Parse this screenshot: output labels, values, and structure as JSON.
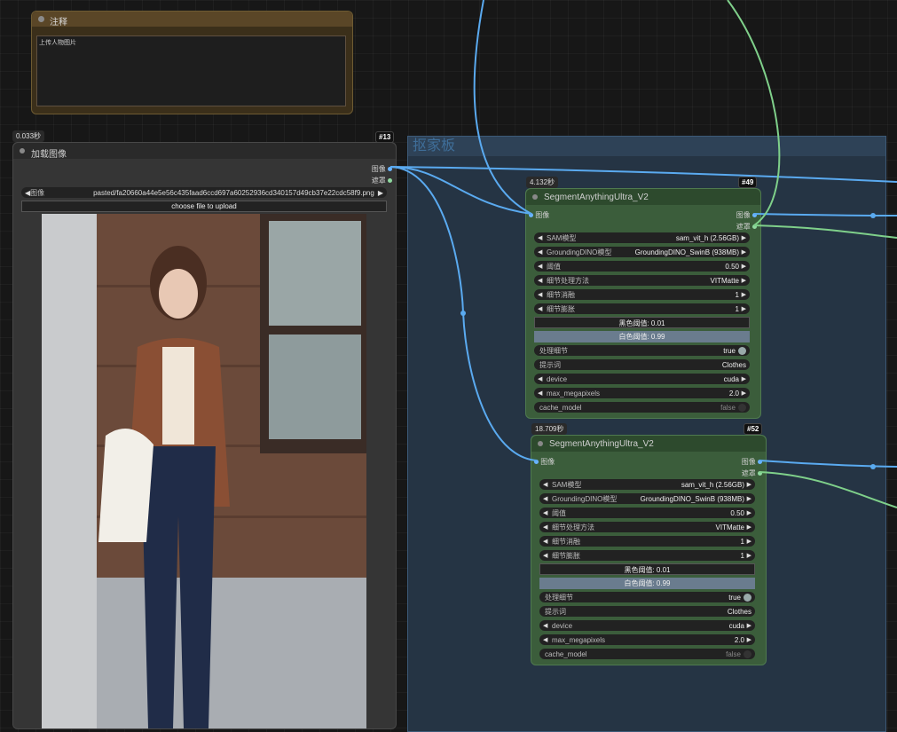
{
  "note": {
    "title": "注释",
    "text": "上传人物图片"
  },
  "group": {
    "title": "抠家板"
  },
  "load_node": {
    "time": "0.033秒",
    "id": "#13",
    "title": "加载图像",
    "outputs": [
      "图像",
      "遮罩"
    ],
    "image_widget_label": "图像",
    "image_filename": "pasted/fa20660a44e5e56c435faad6ccd697a60252936cd340157d49cb37e22cdc58f9.png",
    "upload_button": "choose file to upload"
  },
  "seg_nodes": [
    {
      "time": "4.132秒",
      "id": "#49",
      "title": "SegmentAnythingUltra_V2",
      "input": "图像",
      "outputs": [
        "图像",
        "遮罩"
      ],
      "widgets": [
        {
          "label": "SAM模型",
          "value": "sam_vit_h (2.56GB)"
        },
        {
          "label": "GroundingDINO模型",
          "value": "GroundingDINO_SwinB (938MB)"
        },
        {
          "label": "阈值",
          "value": "0.50"
        },
        {
          "label": "细节处理方法",
          "value": "VITMatte"
        },
        {
          "label": "细节消融",
          "value": "1"
        },
        {
          "label": "细节膨胀",
          "value": "1"
        }
      ],
      "black_point": "黑色阈值: 0.01",
      "white_point": "白色阈值: 0.99",
      "process_detail": {
        "label": "处理细节",
        "value": "true"
      },
      "prompt": {
        "label": "提示词",
        "value": "Clothes"
      },
      "device": {
        "label": "device",
        "value": "cuda"
      },
      "max_megapixels": {
        "label": "max_megapixels",
        "value": "2.0"
      },
      "cache_model": {
        "label": "cache_model",
        "value": "false"
      }
    },
    {
      "time": "18.709秒",
      "id": "#52",
      "title": "SegmentAnythingUltra_V2",
      "input": "图像",
      "outputs": [
        "图像",
        "遮罩"
      ],
      "widgets": [
        {
          "label": "SAM模型",
          "value": "sam_vit_h (2.56GB)"
        },
        {
          "label": "GroundingDINO模型",
          "value": "GroundingDINO_SwinB (938MB)"
        },
        {
          "label": "阈值",
          "value": "0.50"
        },
        {
          "label": "细节处理方法",
          "value": "VITMatte"
        },
        {
          "label": "细节消融",
          "value": "1"
        },
        {
          "label": "细节膨胀",
          "value": "1"
        }
      ],
      "black_point": "黑色阈值: 0.01",
      "white_point": "白色阈值: 0.99",
      "process_detail": {
        "label": "处理细节",
        "value": "true"
      },
      "prompt": {
        "label": "提示词",
        "value": "Clothes"
      },
      "device": {
        "label": "device",
        "value": "cuda"
      },
      "max_megapixels": {
        "label": "max_megapixels",
        "value": "2.0"
      },
      "cache_model": {
        "label": "cache_model",
        "value": "false"
      }
    }
  ],
  "colors": {
    "image_wire": "#5aaaf0",
    "mask_wire": "#7fd08a",
    "group_bg": "#253444",
    "node_green": "#3b5d3b"
  }
}
